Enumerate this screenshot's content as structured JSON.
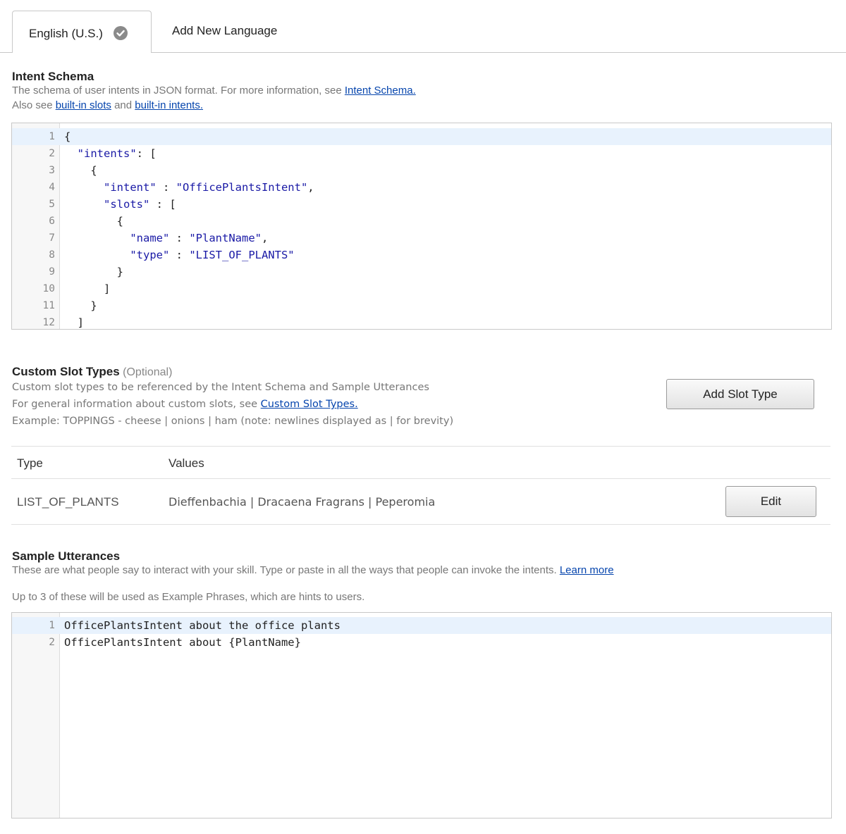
{
  "tabs": {
    "active_label": "English (U.S.)",
    "other_label": "Add New Language"
  },
  "intent_schema": {
    "title": "Intent Schema",
    "desc_prefix": "The schema of user intents in JSON format. For more information, see ",
    "desc_link": "Intent Schema.",
    "also_prefix": "Also see ",
    "also_link1": "built-in slots",
    "also_mid": " and ",
    "also_link2": "built-in intents.",
    "lines": [
      {
        "num": "1",
        "indent": "",
        "key": "",
        "sep": "",
        "val": "",
        "tail": "{"
      },
      {
        "num": "2",
        "indent": "  ",
        "key": "\"intents\"",
        "sep": ": ",
        "val": "",
        "tail": "["
      },
      {
        "num": "3",
        "indent": "    ",
        "key": "",
        "sep": "",
        "val": "",
        "tail": "{"
      },
      {
        "num": "4",
        "indent": "      ",
        "key": "\"intent\"",
        "sep": " : ",
        "val": "\"OfficePlantsIntent\"",
        "tail": ","
      },
      {
        "num": "5",
        "indent": "      ",
        "key": "\"slots\"",
        "sep": " : ",
        "val": "",
        "tail": "["
      },
      {
        "num": "6",
        "indent": "        ",
        "key": "",
        "sep": "",
        "val": "",
        "tail": "{"
      },
      {
        "num": "7",
        "indent": "          ",
        "key": "\"name\"",
        "sep": " : ",
        "val": "\"PlantName\"",
        "tail": ","
      },
      {
        "num": "8",
        "indent": "          ",
        "key": "\"type\"",
        "sep": " : ",
        "val": "\"LIST_OF_PLANTS\"",
        "tail": ""
      },
      {
        "num": "9",
        "indent": "        ",
        "key": "",
        "sep": "",
        "val": "",
        "tail": "}"
      },
      {
        "num": "10",
        "indent": "      ",
        "key": "",
        "sep": "",
        "val": "",
        "tail": "]"
      },
      {
        "num": "11",
        "indent": "    ",
        "key": "",
        "sep": "",
        "val": "",
        "tail": "}"
      },
      {
        "num": "12",
        "indent": "  ",
        "key": "",
        "sep": "",
        "val": "",
        "tail": "]"
      }
    ]
  },
  "custom_slots": {
    "title": "Custom Slot Types",
    "optional": "(Optional)",
    "desc1": "Custom slot types to be referenced by the Intent Schema and Sample Utterances",
    "desc2_prefix": "For general information about custom slots, see ",
    "desc2_link": "Custom Slot Types.",
    "desc3": "Example: TOPPINGS - cheese | onions | ham (note: newlines displayed as | for brevity)",
    "add_button": "Add Slot Type",
    "col_type": "Type",
    "col_values": "Values",
    "rows": [
      {
        "type": "LIST_OF_PLANTS",
        "values": "Dieffenbachia | Dracaena Fragrans | Peperomia",
        "edit": "Edit"
      }
    ]
  },
  "sample_utterances": {
    "title": "Sample Utterances",
    "desc_prefix": "These are what people say to interact with your skill. Type or paste in all the ways that people can invoke the intents. ",
    "desc_link": "Learn more",
    "note": "Up to 3 of these will be used as Example Phrases, which are hints to users.",
    "lines": [
      {
        "num": "1",
        "text": "OfficePlantsIntent about the office plants"
      },
      {
        "num": "2",
        "text": "OfficePlantsIntent about {PlantName}"
      }
    ]
  },
  "colors": {
    "link": "#0645ad",
    "string": "#1a1aa6",
    "active_line": "#e8f2fd"
  },
  "icons": {
    "tab_check": "check-circle-icon"
  }
}
